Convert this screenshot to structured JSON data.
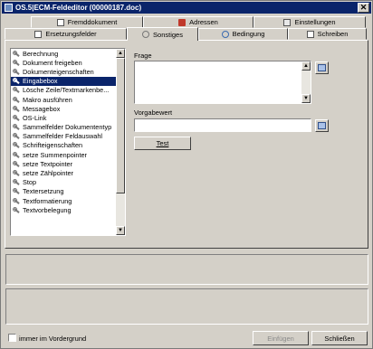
{
  "window": {
    "title": "OS.5|ECM-Feldeditor (00000187.doc)",
    "close_glyph": "✕"
  },
  "tabs_back": [
    {
      "label": "Fremddokument",
      "icon": "document-icon"
    },
    {
      "label": "Adressen",
      "icon": "contacts-icon"
    },
    {
      "label": "Einstellungen",
      "icon": "settings-icon"
    }
  ],
  "tabs_front": [
    {
      "label": "Ersetzungsfelder",
      "icon": "fields-icon"
    },
    {
      "label": "Sonstiges",
      "icon": "wrench-icon"
    },
    {
      "label": "Bedingung",
      "icon": "condition-icon"
    },
    {
      "label": "Schreiben",
      "icon": "write-icon"
    }
  ],
  "functions": [
    "Berechnung",
    "Dokument freigeben",
    "Dokumenteigenschaften",
    "Eingabebox",
    "Lösche Zeile/Textmarkenbe...",
    "Makro ausführen",
    "Messagebox",
    "OS-Link",
    "Sammelfelder Dokumententyp",
    "Sammelfelder Feldauswahl",
    "Schrifteigenschaften",
    "setze Summenpointer",
    "setze Textpointer",
    "setze Zählpointer",
    "Stop",
    "Textersetzung",
    "Textformatierung",
    "Textvorbelegung"
  ],
  "selected_index": 3,
  "form": {
    "frage_label": "Frage",
    "vorgabe_label": "Vorgabewert",
    "test_label": "Test",
    "frage_value": "",
    "vorgabe_value": ""
  },
  "footer": {
    "always_on_top_label": "immer im Vordergrund",
    "insert_label": "Einfügen",
    "close_label": "Schließen"
  },
  "colors": {
    "selection": "#0a246a",
    "titlebar": "#0a246a",
    "face": "#d4d0c8"
  }
}
